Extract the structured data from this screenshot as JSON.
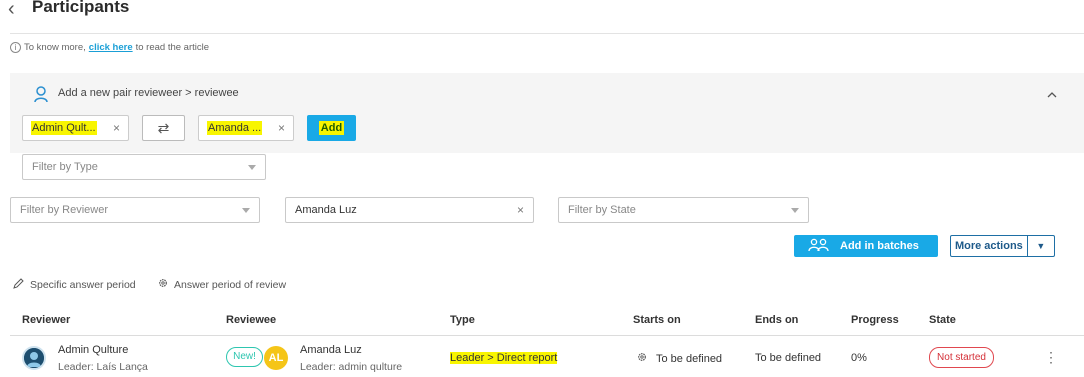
{
  "header": {
    "back_icon": "chevron-left-icon",
    "title": "Participants"
  },
  "info": {
    "icon": "info-icon",
    "prefix": "To know more, ",
    "link": "click here",
    "suffix": " to read the article"
  },
  "add_pair": {
    "icon": "user-icon",
    "title": "Add a new pair revieweer > reviewee",
    "reviewer_value": "Admin Qult...",
    "reviewee_value": "Amanda ...",
    "swap_icon": "swap-arrows-icon",
    "add_label": "Add",
    "collapse_icon": "chevron-up-icon"
  },
  "filters": {
    "type_placeholder": "Filter by Type",
    "reviewer_placeholder": "Filter by Reviewer",
    "reviewee_value": "Amanda Luz",
    "state_placeholder": "Filter by State"
  },
  "actions": {
    "batches_icon": "group-icon",
    "batches_label": "Add in batches",
    "more_label": "More actions",
    "more_caret": "▼"
  },
  "periods": {
    "specific_label": "Specific answer period",
    "review_label": "Answer period of review"
  },
  "table": {
    "columns": {
      "reviewer": "Reviewer",
      "reviewee": "Reviewee",
      "type": "Type",
      "starts_on": "Starts on",
      "ends_on": "Ends on",
      "progress": "Progress",
      "state": "State"
    },
    "rows": [
      {
        "reviewer_name": "Admin Qulture",
        "reviewer_leader": "Leader: Laís Lança",
        "new_badge": "New!",
        "reviewee_initials": "AL",
        "reviewee_name": "Amanda Luz",
        "reviewee_leader": "Leader: admin qulture",
        "type": "Leader > Direct report",
        "starts_on": "To be defined",
        "ends_on": "To be defined",
        "progress": "0%",
        "state": "Not started"
      }
    ]
  },
  "colors": {
    "accent": "#19a9e6",
    "highlight": "#f8f500",
    "danger": "#d42f37",
    "new_badge": "#2ec6b0"
  }
}
